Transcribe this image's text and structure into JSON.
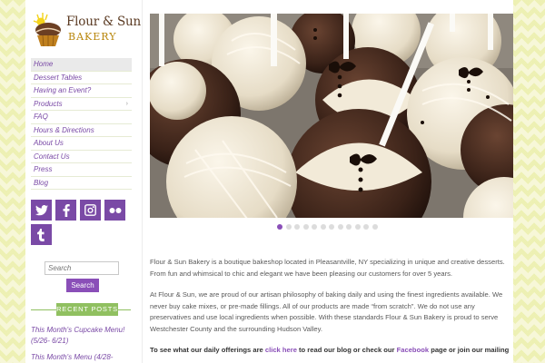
{
  "brand": {
    "name_line1": "Flour & Sun",
    "name_line2": "BAKERY",
    "colors": {
      "purple": "#7a4aa6",
      "green": "#90c060",
      "brown": "#5a3a22"
    }
  },
  "nav": {
    "items": [
      {
        "label": "Home",
        "active": true
      },
      {
        "label": "Dessert Tables"
      },
      {
        "label": "Having an Event?"
      },
      {
        "label": "Products",
        "has_submenu": true,
        "submenu_glyph": "›"
      },
      {
        "label": "FAQ"
      },
      {
        "label": "Hours & Directions"
      },
      {
        "label": "About Us"
      },
      {
        "label": "Contact Us"
      },
      {
        "label": "Press"
      },
      {
        "label": "Blog"
      }
    ]
  },
  "social": [
    {
      "icon": "twitter-icon"
    },
    {
      "icon": "facebook-icon"
    },
    {
      "icon": "instagram-icon"
    },
    {
      "icon": "flickr-icon"
    },
    {
      "icon": "tumblr-icon"
    }
  ],
  "search": {
    "placeholder": "Search",
    "button_label": "Search"
  },
  "recent_posts": {
    "heading": "RECENT POSTS",
    "items": [
      {
        "title": "This Month's Cupcake Menu! (5/26- 6/21)"
      },
      {
        "title": "This Month's Menu (4/28-"
      }
    ]
  },
  "slider": {
    "slide_count": 12,
    "active_index": 0
  },
  "content": {
    "para1": "Flour & Sun Bakery is a boutique bakeshop located in Pleasantville, NY specializing in unique and creative desserts. From fun and whimsical to chic and elegant we have been pleasing our customers for over 5 years.",
    "para2": "At Flour & Sun, we are proud of our artisan philosophy of baking daily and using the finest ingredients available. We never buy cake mixes, or pre-made fillings. All of our products are made “from scratch”. We do not use any preservatives and use local ingredients when possible. With these standards Flour & Sun Bakery is proud to serve Westchester County and the surrounding Hudson Valley.",
    "cta_prefix": "To see what our daily offerings are ",
    "cta_link1": "click here",
    "cta_mid": " to read our blog or check our ",
    "cta_link2": "Facebook",
    "cta_suffix": " page or join our mailing"
  }
}
